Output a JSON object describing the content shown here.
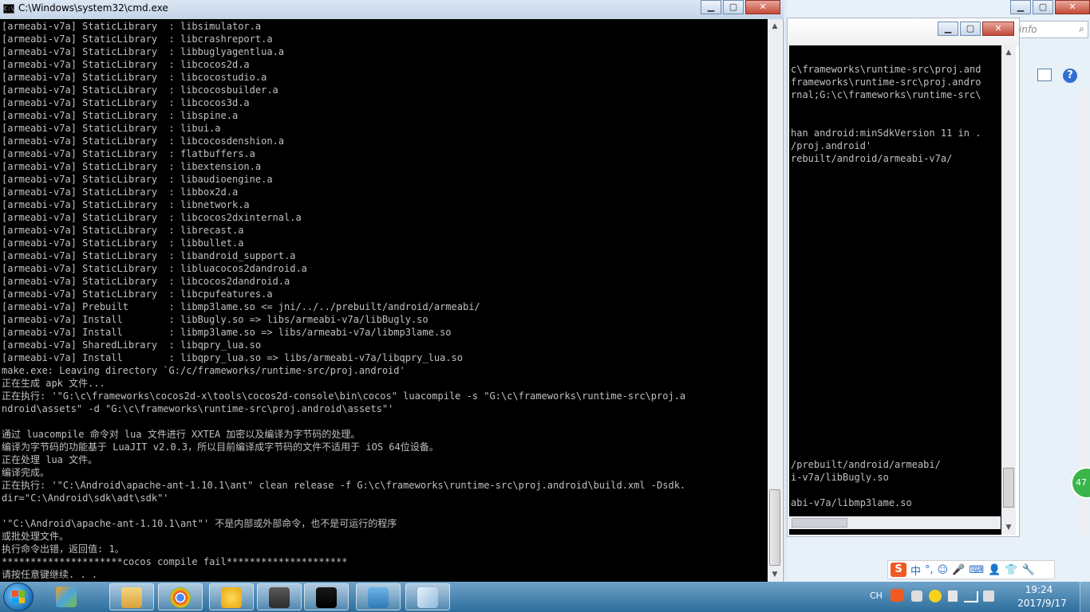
{
  "main_window": {
    "title": "C:\\Windows\\system32\\cmd.exe",
    "minimize": "▁",
    "maximize": "▢",
    "close": "✕",
    "lines": [
      "[armeabi-v7a] StaticLibrary  : libsimulator.a",
      "[armeabi-v7a] StaticLibrary  : libcrashreport.a",
      "[armeabi-v7a] StaticLibrary  : libbuglyagentlua.a",
      "[armeabi-v7a] StaticLibrary  : libcocos2d.a",
      "[armeabi-v7a] StaticLibrary  : libcocostudio.a",
      "[armeabi-v7a] StaticLibrary  : libcocosbuilder.a",
      "[armeabi-v7a] StaticLibrary  : libcocos3d.a",
      "[armeabi-v7a] StaticLibrary  : libspine.a",
      "[armeabi-v7a] StaticLibrary  : libui.a",
      "[armeabi-v7a] StaticLibrary  : libcocosdenshion.a",
      "[armeabi-v7a] StaticLibrary  : flatbuffers.a",
      "[armeabi-v7a] StaticLibrary  : libextension.a",
      "[armeabi-v7a] StaticLibrary  : libaudioengine.a",
      "[armeabi-v7a] StaticLibrary  : libbox2d.a",
      "[armeabi-v7a] StaticLibrary  : libnetwork.a",
      "[armeabi-v7a] StaticLibrary  : libcocos2dxinternal.a",
      "[armeabi-v7a] StaticLibrary  : librecast.a",
      "[armeabi-v7a] StaticLibrary  : libbullet.a",
      "[armeabi-v7a] StaticLibrary  : libandroid_support.a",
      "[armeabi-v7a] StaticLibrary  : libluacocos2dandroid.a",
      "[armeabi-v7a] StaticLibrary  : libcocos2dandroid.a",
      "[armeabi-v7a] StaticLibrary  : libcpufeatures.a",
      "[armeabi-v7a] Prebuilt       : libmp3lame.so <= jni/../../prebuilt/android/armeabi/",
      "[armeabi-v7a] Install        : libBugly.so => libs/armeabi-v7a/libBugly.so",
      "[armeabi-v7a] Install        : libmp3lame.so => libs/armeabi-v7a/libmp3lame.so",
      "[armeabi-v7a] SharedLibrary  : libqpry_lua.so",
      "[armeabi-v7a] Install        : libqpry_lua.so => libs/armeabi-v7a/libqpry_lua.so",
      "make.exe: Leaving directory `G:/c/frameworks/runtime-src/proj.android'",
      "正在生成 apk 文件...",
      "正在执行: '\"G:\\c\\frameworks\\cocos2d-x\\tools\\cocos2d-console\\bin\\cocos\" luacompile -s \"G:\\c\\frameworks\\runtime-src\\proj.a",
      "ndroid\\assets\" -d \"G:\\c\\frameworks\\runtime-src\\proj.android\\assets\"'",
      "",
      "通过 luacompile 命令对 lua 文件进行 XXTEA 加密以及编译为字节码的处理。",
      "编译为字节码的功能基于 LuaJIT v2.0.3，所以目前编译成字节码的文件不适用于 iOS 64位设备。",
      "正在处理 lua 文件。",
      "编译完成。",
      "正在执行: '\"C:\\Android\\apache-ant-1.10.1\\ant\" clean release -f G:\\c\\frameworks\\runtime-src\\proj.android\\build.xml -Dsdk.",
      "dir=\"C:\\Android\\sdk\\adt\\sdk\"'",
      "",
      "'\"C:\\Android\\apache-ant-1.10.1\\ant\"' 不是内部或外部命令，也不是可运行的程序",
      "或批处理文件。",
      "执行命令出错，返回值: 1。",
      "*********************cocos compile fail*********************",
      "请按任意键继续. . ."
    ]
  },
  "second_window": {
    "minimize": "▁",
    "maximize": "▢",
    "close": "✕",
    "lines": [
      {
        "row": 3,
        "text": "c\\frameworks\\runtime-src\\proj.and"
      },
      {
        "row": 4,
        "text": "frameworks\\runtime-src\\proj.andro"
      },
      {
        "row": 5,
        "text": "rnal;G:\\c\\frameworks\\runtime-src\\"
      },
      {
        "row": 8,
        "text": "han android:minSdkVersion 11 in ."
      },
      {
        "row": 9,
        "text": "/proj.android'"
      },
      {
        "row": 10,
        "text": "rebuilt/android/armeabi-v7a/"
      },
      {
        "row": 34,
        "text": "/prebuilt/android/armeabi/"
      },
      {
        "row": 35,
        "text": "i-v7a/libBugly.so"
      },
      {
        "row": 37,
        "text": "abi-v7a/libmp3lame.so"
      }
    ]
  },
  "background_window": {
    "minimize": "▁",
    "maximize": "▢",
    "close": "✕",
    "search_text": "f info",
    "search_icon": "⌕",
    "help": "?",
    "badge": "47"
  },
  "ime": {
    "logo": "S",
    "items": [
      "中",
      "°,",
      "☺",
      "🎤",
      "⌨",
      "👤",
      "👕",
      "🔧"
    ]
  },
  "taskbar": {
    "apps": [
      "windows-photo-gallery",
      "file-explorer",
      "chrome",
      "qq-chick",
      "sublime-text",
      "cmd",
      "remote-desktop",
      "paint"
    ],
    "tray_lang": "CH",
    "clock_time": "19:24",
    "clock_date": "2017/9/17"
  },
  "colors": {
    "console_text": "#c0c0c0",
    "console_bg": "#000000",
    "taskbar": "#2d6d9c"
  }
}
